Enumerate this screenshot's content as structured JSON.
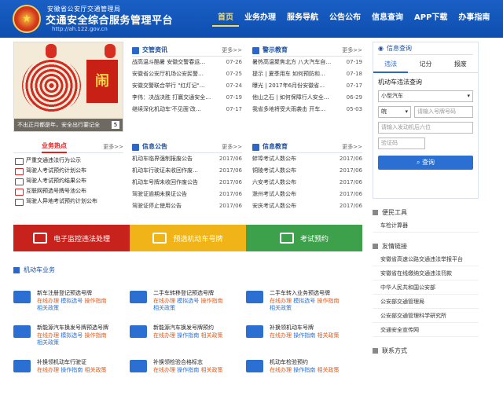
{
  "header": {
    "bureau": "安徽省公安厅交通管理局",
    "platform": "交通安全综合服务管理平台",
    "url": "http://ah.122.gov.cn",
    "nav": [
      "首页",
      "业务办理",
      "服务导航",
      "公告公布",
      "信息查询",
      "APP下载",
      "办事指南"
    ],
    "active_nav": "首页"
  },
  "banner": {
    "caption": "不出正月都是年，安全出行要记全",
    "page": "5"
  },
  "police_news": {
    "title": "交管资讯",
    "more": "更多>>",
    "items": [
      {
        "text": "战高温斗酷暑 安徽交警春运…",
        "date": "07-26"
      },
      {
        "text": "安徽省公安厅机场公安民警…",
        "date": "07-25"
      },
      {
        "text": "安徽交警联合举行 \"红灯记\"…",
        "date": "07-24"
      },
      {
        "text": "李伟：决战决胜 打赢交通安全…",
        "date": "07-19"
      },
      {
        "text": "继续深化机动车'不见面'改…",
        "date": "07-17"
      }
    ]
  },
  "warning_edu": {
    "title": "警示教育",
    "more": "更多>>",
    "items": [
      {
        "text": "暑热高温聚焦北方 八大汽车自…",
        "date": "07-19"
      },
      {
        "text": "提示 | 夏季用车 如何预防和…",
        "date": "07-18"
      },
      {
        "text": "曝光 | 2017年6月份安徽省…",
        "date": "07-17"
      },
      {
        "text": "他山之石 | 如何保障行人安全…",
        "date": "06-29"
      },
      {
        "text": "我省多地将受大雨袭击 开车…",
        "date": "05-03"
      }
    ]
  },
  "hot_business": {
    "title": "业务热点",
    "more": "更多>>",
    "items": [
      "严重交通违法行为公示",
      "驾驶人考试预约计划公布",
      "驾驶人考试预约结果公布",
      "互联网预选号牌号池公布",
      "驾驶人异地考试预约计划公布"
    ]
  },
  "info_announce": {
    "title": "信息公告",
    "more": "更多>>",
    "items": [
      {
        "text": "机动车临界强制报废公告",
        "date": "2017/06"
      },
      {
        "text": "机动车行驶证未收回作废…",
        "date": "2017/06"
      },
      {
        "text": "机动车号牌未收回作废公告",
        "date": "2017/06"
      },
      {
        "text": "驾驶证逾期未换证公告",
        "date": "2017/06"
      },
      {
        "text": "驾驶证停止使用公告",
        "date": "2017/06"
      }
    ]
  },
  "info_edu": {
    "title": "信息教育",
    "more": "更多>>",
    "items": [
      {
        "text": "蚌埠考试人数公布",
        "date": "2017/06"
      },
      {
        "text": "铜陵考试人数公布",
        "date": "2017/06"
      },
      {
        "text": "六安考试人数公布",
        "date": "2017/06"
      },
      {
        "text": "滁州考试人数公布",
        "date": "2017/06"
      },
      {
        "text": "安庆考试人数公布",
        "date": "2017/06"
      }
    ]
  },
  "quick_links": [
    {
      "label": "电子监控违法处理",
      "color": "#c8221d"
    },
    {
      "label": "预选机动车号牌",
      "color": "#f0b418"
    },
    {
      "label": "考试预约",
      "color": "#3da14b"
    }
  ],
  "vehicle": {
    "title": "机动车业务",
    "services": [
      {
        "name": "新车注册登记预选号牌",
        "l1": "在线办理",
        "l1b": "模拟选号",
        "l1c": "操作指南",
        "l2": "相关政策"
      },
      {
        "name": "二手车转移登记预选号牌",
        "l1": "在线办理",
        "l1b": "模拟选号",
        "l1c": "操作指南",
        "l2": "相关政策"
      },
      {
        "name": "二手车转入业务预选号牌",
        "l1": "在线办理",
        "l1b": "模拟选号",
        "l1c": "操作指南",
        "l2": "相关政策"
      },
      {
        "name": "新能源汽车换发号牌预选号牌",
        "l1": "在线办理",
        "l1b": "模拟选号",
        "l1c": "操作指南",
        "l2": "相关政策"
      },
      {
        "name": "新能源汽车换发号牌预约",
        "l1": "在线办理",
        "l1b": "操作指南",
        "l1c": "相关政策",
        "l2": ""
      },
      {
        "name": "补换领机动车号牌",
        "l1": "在线办理",
        "l1b": "操作指南",
        "l1c": "相关政策",
        "l2": ""
      },
      {
        "name": "补换领机动车行驶证",
        "l1": "在线办理",
        "l1b": "操作指南",
        "l1c": "相关政策",
        "l2": ""
      },
      {
        "name": "补换领检验合格标志",
        "l1": "在线办理",
        "l1b": "操作指南",
        "l1c": "相关政策",
        "l2": ""
      },
      {
        "name": "机动车检验预约",
        "l1": "在线办理",
        "l1b": "操作指南",
        "l1c": "相关政策",
        "l2": ""
      }
    ]
  },
  "sidebar": {
    "query_title": "信息查询",
    "tabs": [
      "违法",
      "记分",
      "报废"
    ],
    "form_title": "机动车违法查询",
    "vehicle_type": "小型汽车",
    "province": "皖",
    "plate_placeholder": "请输入号牌号码",
    "engine_placeholder": "请输入发动机后六位",
    "captcha_placeholder": "验证码",
    "query_btn": "查询",
    "tools_title": "便民工具",
    "tools": [
      "车检计算器"
    ],
    "links_title": "友情链接",
    "links": [
      "安徽省高速公路交通违法举报平台",
      "安徽省在线缴纳交通违法罚款",
      "中华人民共和国公安部",
      "公安部交通管理局",
      "公安部交通管理科学研究所",
      "交通安全宣传网"
    ],
    "contact_title": "联系方式"
  }
}
